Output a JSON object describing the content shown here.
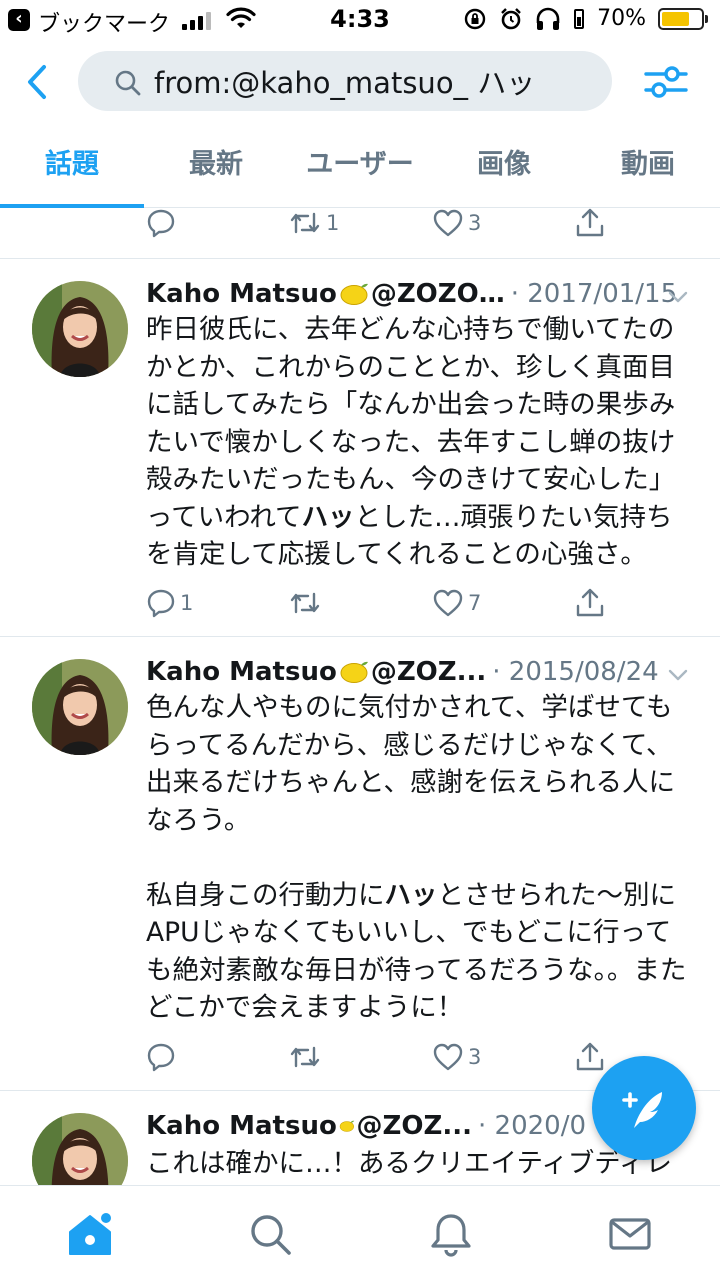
{
  "status_bar": {
    "back_app_label": "ブックマーク",
    "time": "4:33",
    "battery_percent": "70%",
    "battery_level": 0.7
  },
  "search": {
    "query": "from:@kaho_matsuo_ ハッ"
  },
  "tabs": [
    {
      "label": "話題",
      "active": true
    },
    {
      "label": "最新",
      "active": false
    },
    {
      "label": "ユーザー",
      "active": false
    },
    {
      "label": "画像",
      "active": false
    },
    {
      "label": "動画",
      "active": false
    }
  ],
  "previous_tweet": {
    "replies": "",
    "retweets": "1",
    "likes": "3"
  },
  "tweets": [
    {
      "name": "Kaho Matsuo",
      "handle": "@ZOZO…",
      "date": "· 2017/01/15",
      "text_before": "昨日彼氏に、去年どんな心持ちで働いてたのかとか、これからのこととか、珍しく真面目に話してみたら「なんか出会った時の果歩みたいで懐かしくなった、去年すこし蝉の抜け殻みたいだったもん、今のきけて安心した」っていわれて",
      "text_bold": "ハッ",
      "text_after": "とした…頑張りたい気持ちを肯定して応援してくれることの心強さ。",
      "replies": "1",
      "retweets": "",
      "likes": "7"
    },
    {
      "name": "Kaho Matsuo",
      "handle": "@ZOZ...",
      "date": "· 2015/08/24",
      "text_before": "色んな人やものに気付かされて、学ばせてもらってるんだから、感じるだけじゃなくて、出来るだけちゃんと、感謝を伝えられる人になろう。\n\n私自身この行動力に",
      "text_bold": "ハッ",
      "text_after": "とさせられた〜別にAPUじゃなくてもいいし、でもどこに行っても絶対素敵な毎日が待ってるだろうな。。またどこかで会えますように！",
      "replies": "",
      "retweets": "",
      "likes": "3"
    },
    {
      "name": "Kaho Matsuo",
      "handle": "@ZOZ...",
      "date": "· 2020/0",
      "text_before": "これは確かに…！あるクリエイティブディレ",
      "text_bold": "",
      "text_after": ""
    }
  ],
  "icons": {
    "back": "chevron-left-icon",
    "search": "search-icon",
    "filter": "filter-sliders-icon",
    "compose": "compose-feather-icon",
    "home": "home-icon",
    "explore": "search-icon",
    "notifications": "bell-icon",
    "messages": "mail-icon"
  },
  "colors": {
    "accent": "#1da1f2",
    "muted": "#657786",
    "text": "#14171a",
    "search_bg": "#e6ecf0"
  }
}
